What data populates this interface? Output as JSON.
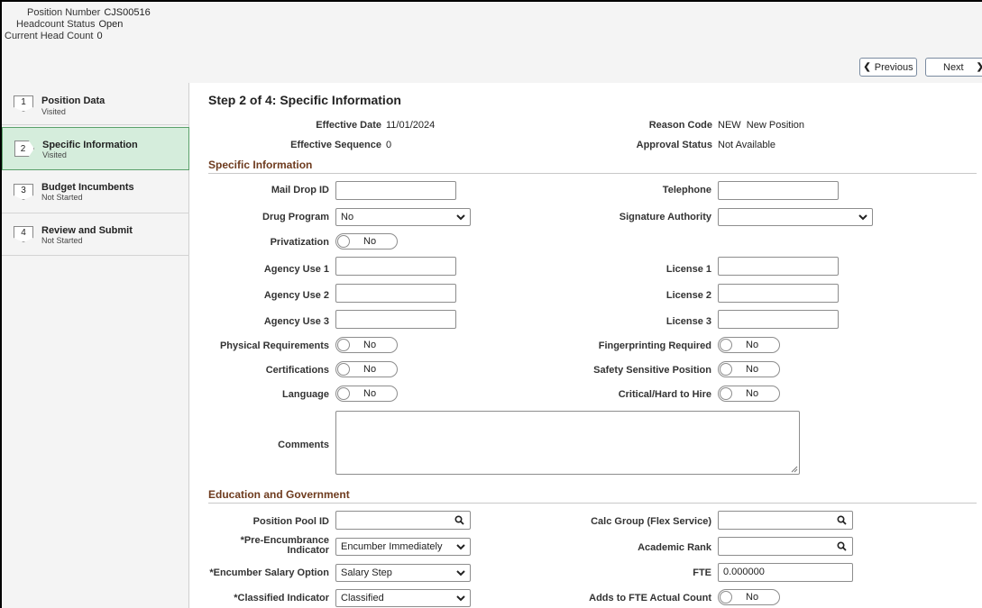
{
  "header": {
    "position_number_label": "Position Number",
    "position_number": "CJS00516",
    "headcount_status_label": "Headcount Status",
    "headcount_status": "Open",
    "current_head_count_label": "Current Head Count",
    "current_head_count": "0"
  },
  "nav_buttons": {
    "previous": "Previous",
    "next": "Next"
  },
  "steps": [
    {
      "num": "1",
      "title": "Position Data",
      "status": "Visited"
    },
    {
      "num": "2",
      "title": "Specific Information",
      "status": "Visited"
    },
    {
      "num": "3",
      "title": "Budget Incumbents",
      "status": "Not Started"
    },
    {
      "num": "4",
      "title": "Review and Submit",
      "status": "Not Started"
    }
  ],
  "page_title": "Step 2 of 4: Specific Information",
  "summary": {
    "effective_date_label": "Effective Date",
    "effective_date": "11/01/2024",
    "effective_sequence_label": "Effective Sequence",
    "effective_sequence": "0",
    "reason_code_label": "Reason Code",
    "reason_code": "NEW",
    "reason_desc": "New Position",
    "approval_status_label": "Approval Status",
    "approval_status": "Not Available"
  },
  "specific_section": {
    "heading": "Specific Information",
    "mail_drop_label": "Mail Drop ID",
    "mail_drop": "",
    "telephone_label": "Telephone",
    "telephone": "",
    "drug_program_label": "Drug Program",
    "drug_program": "No",
    "signature_authority_label": "Signature Authority",
    "signature_authority": "",
    "privatization_label": "Privatization",
    "agency_use_1_label": "Agency Use 1",
    "agency_use_2_label": "Agency Use 2",
    "agency_use_3_label": "Agency Use 3",
    "license_1_label": "License 1",
    "license_2_label": "License 2",
    "license_3_label": "License 3",
    "physical_req_label": "Physical Requirements",
    "certifications_label": "Certifications",
    "language_label": "Language",
    "fingerprinting_label": "Fingerprinting Required",
    "safety_sensitive_label": "Safety Sensitive Position",
    "critical_hire_label": "Critical/Hard to Hire",
    "comments_label": "Comments",
    "toggle_text": "No"
  },
  "education_section": {
    "heading": "Education and Government",
    "position_pool_label": "Position Pool ID",
    "pre_encumbrance_label": "*Pre-Encumbrance Indicator",
    "pre_encumbrance": "Encumber Immediately",
    "encumber_salary_label": "*Encumber Salary Option",
    "encumber_salary": "Salary Step",
    "classified_label": "*Classified Indicator",
    "classified": "Classified",
    "calc_group_label": "Calc Group (Flex Service)",
    "academic_rank_label": "Academic Rank",
    "fte_label": "FTE",
    "fte": "0.000000",
    "adds_fte_label": "Adds to FTE Actual Count",
    "toggle_text": "No"
  },
  "icons": [
    "chevron-left-icon",
    "chevron-right-icon",
    "dropdown-caret-icon",
    "lookup-search-icon",
    "resize-grip-icon"
  ],
  "colors": {
    "active_step_bg": "#d5eddc",
    "section_heading": "#6e3b1e",
    "header_bg": "#f4f4f4"
  }
}
